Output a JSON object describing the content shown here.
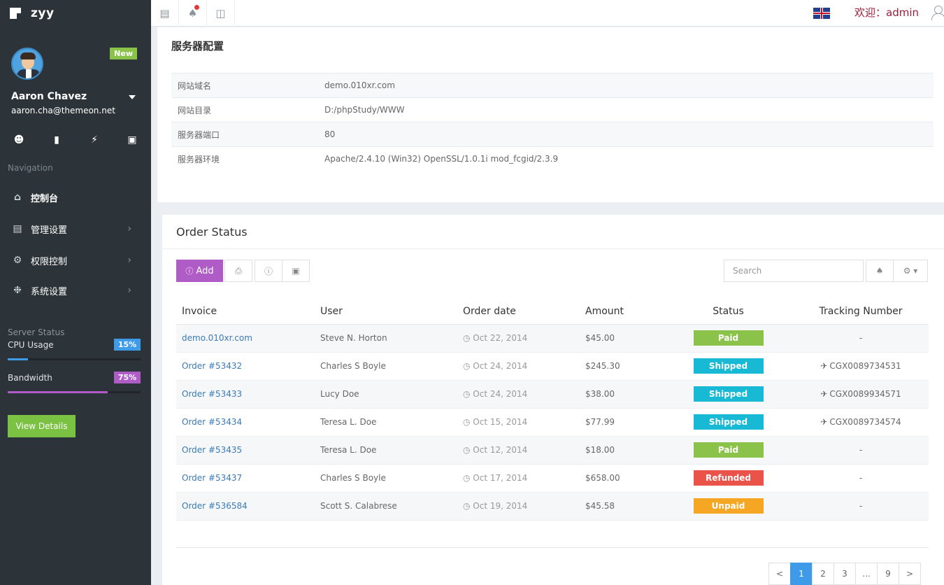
{
  "brand": {
    "name": "zyy"
  },
  "profile": {
    "badge": "New",
    "name": "Aaron Chavez",
    "email": "aaron.cha@themeon.net",
    "quick_icons": [
      "user-icon",
      "chat-icon",
      "bolt-icon",
      "lock-icon"
    ]
  },
  "nav": {
    "title": "Navigation",
    "items": [
      {
        "label": "控制台",
        "icon": "home-icon",
        "active": true
      },
      {
        "label": "管理设置",
        "icon": "book-icon"
      },
      {
        "label": "权限控制",
        "icon": "gear-icon"
      },
      {
        "label": "系统设置",
        "icon": "cog-icon"
      }
    ]
  },
  "server_status": {
    "title": "Server Status",
    "cpu": {
      "label": "CPU Usage",
      "value": "15%",
      "percent": 15,
      "color": "#3d9be9"
    },
    "bandwidth": {
      "label": "Bandwidth",
      "value": "75%",
      "percent": 75,
      "color": "#b05cc7"
    },
    "button": "View Details"
  },
  "topbar": {
    "welcome_prefix": "欢迎：",
    "user": "admin"
  },
  "server_config": {
    "title": "服务器配置",
    "rows": [
      {
        "key": "网站域名",
        "value": "demo.010xr.com"
      },
      {
        "key": "网站目录",
        "value": "D:/phpStudy/WWW"
      },
      {
        "key": "服务器端口",
        "value": "80"
      },
      {
        "key": "服务器环境",
        "value": "Apache/2.4.10 (Win32) OpenSSL/1.0.1i mod_fcgid/2.3.9"
      }
    ]
  },
  "orders": {
    "title": "Order Status",
    "add_label": "Add",
    "search_placeholder": "Search",
    "columns": [
      "Invoice",
      "User",
      "Order date",
      "Amount",
      "Status",
      "Tracking Number"
    ],
    "rows": [
      {
        "invoice": "demo.010xr.com",
        "user": "Steve N. Horton",
        "date": "Oct 22, 2014",
        "amount": "$45.00",
        "status": "Paid",
        "tracking": "-"
      },
      {
        "invoice": "Order #53432",
        "user": "Charles S Boyle",
        "date": "Oct 24, 2014",
        "amount": "$245.30",
        "status": "Shipped",
        "tracking": "CGX0089734531"
      },
      {
        "invoice": "Order #53433",
        "user": "Lucy Doe",
        "date": "Oct 24, 2014",
        "amount": "$38.00",
        "status": "Shipped",
        "tracking": "CGX0089934571"
      },
      {
        "invoice": "Order #53434",
        "user": "Teresa L. Doe",
        "date": "Oct 15, 2014",
        "amount": "$77.99",
        "status": "Shipped",
        "tracking": "CGX0089734574"
      },
      {
        "invoice": "Order #53435",
        "user": "Teresa L. Doe",
        "date": "Oct 12, 2014",
        "amount": "$18.00",
        "status": "Paid",
        "tracking": "-"
      },
      {
        "invoice": "Order #53437",
        "user": "Charles S Boyle",
        "date": "Oct 17, 2014",
        "amount": "$658.00",
        "status": "Refunded",
        "tracking": "-"
      },
      {
        "invoice": "Order #536584",
        "user": "Scott S. Calabrese",
        "date": "Oct 19, 2014",
        "amount": "$45.58",
        "status": "Unpaid",
        "tracking": "-"
      }
    ],
    "status_colors": {
      "Paid": "#8bc34a",
      "Shipped": "#17b9d4",
      "Refunded": "#ea5349",
      "Unpaid": "#f5a623"
    },
    "pagination": [
      "<",
      "1",
      "2",
      "3",
      "...",
      "9",
      ">"
    ],
    "current_page": "1"
  }
}
